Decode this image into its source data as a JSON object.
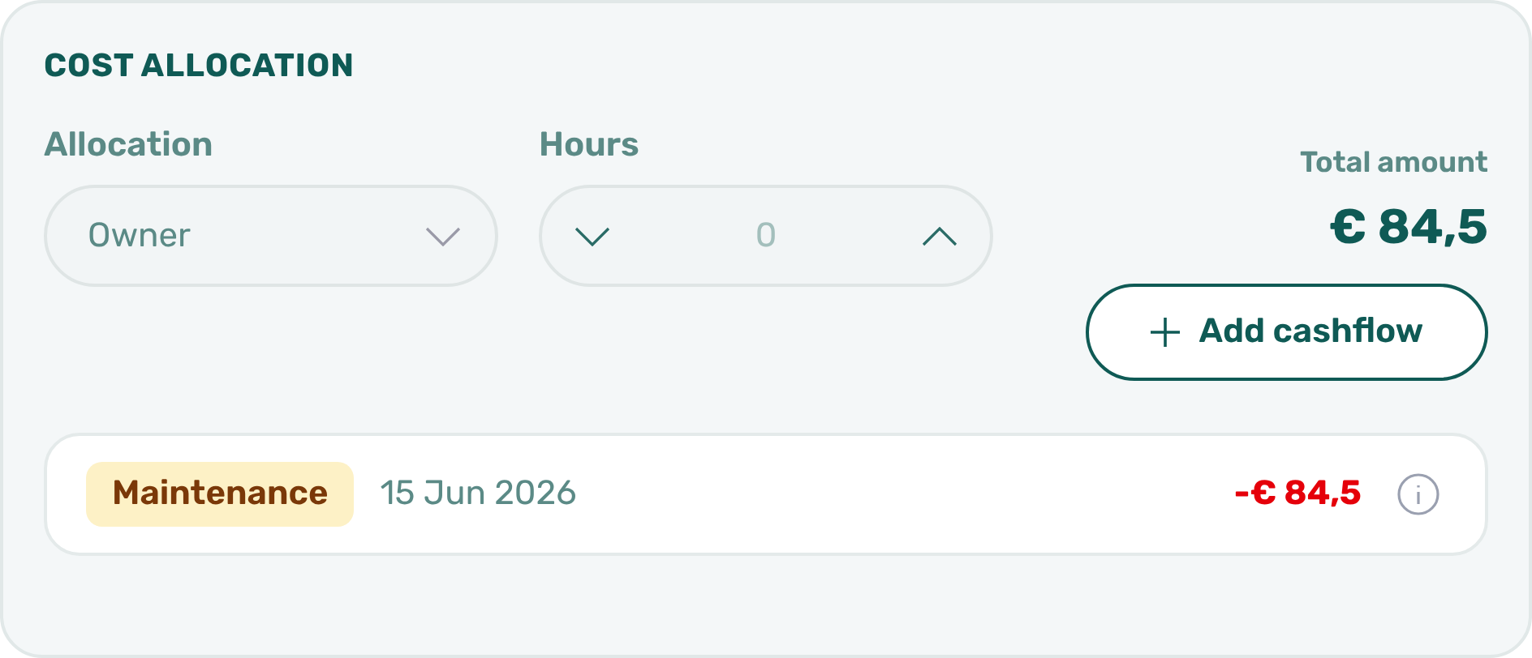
{
  "title": "COST ALLOCATION",
  "allocation": {
    "label": "Allocation",
    "value": "Owner"
  },
  "hours": {
    "label": "Hours",
    "value": "0"
  },
  "total": {
    "label": "Total amount",
    "value": "€ 84,5"
  },
  "add_button": {
    "label": "Add cashflow"
  },
  "entries": [
    {
      "tag": "Maintenance",
      "date": "15 Jun 2026",
      "amount": "-€ 84,5"
    }
  ]
}
